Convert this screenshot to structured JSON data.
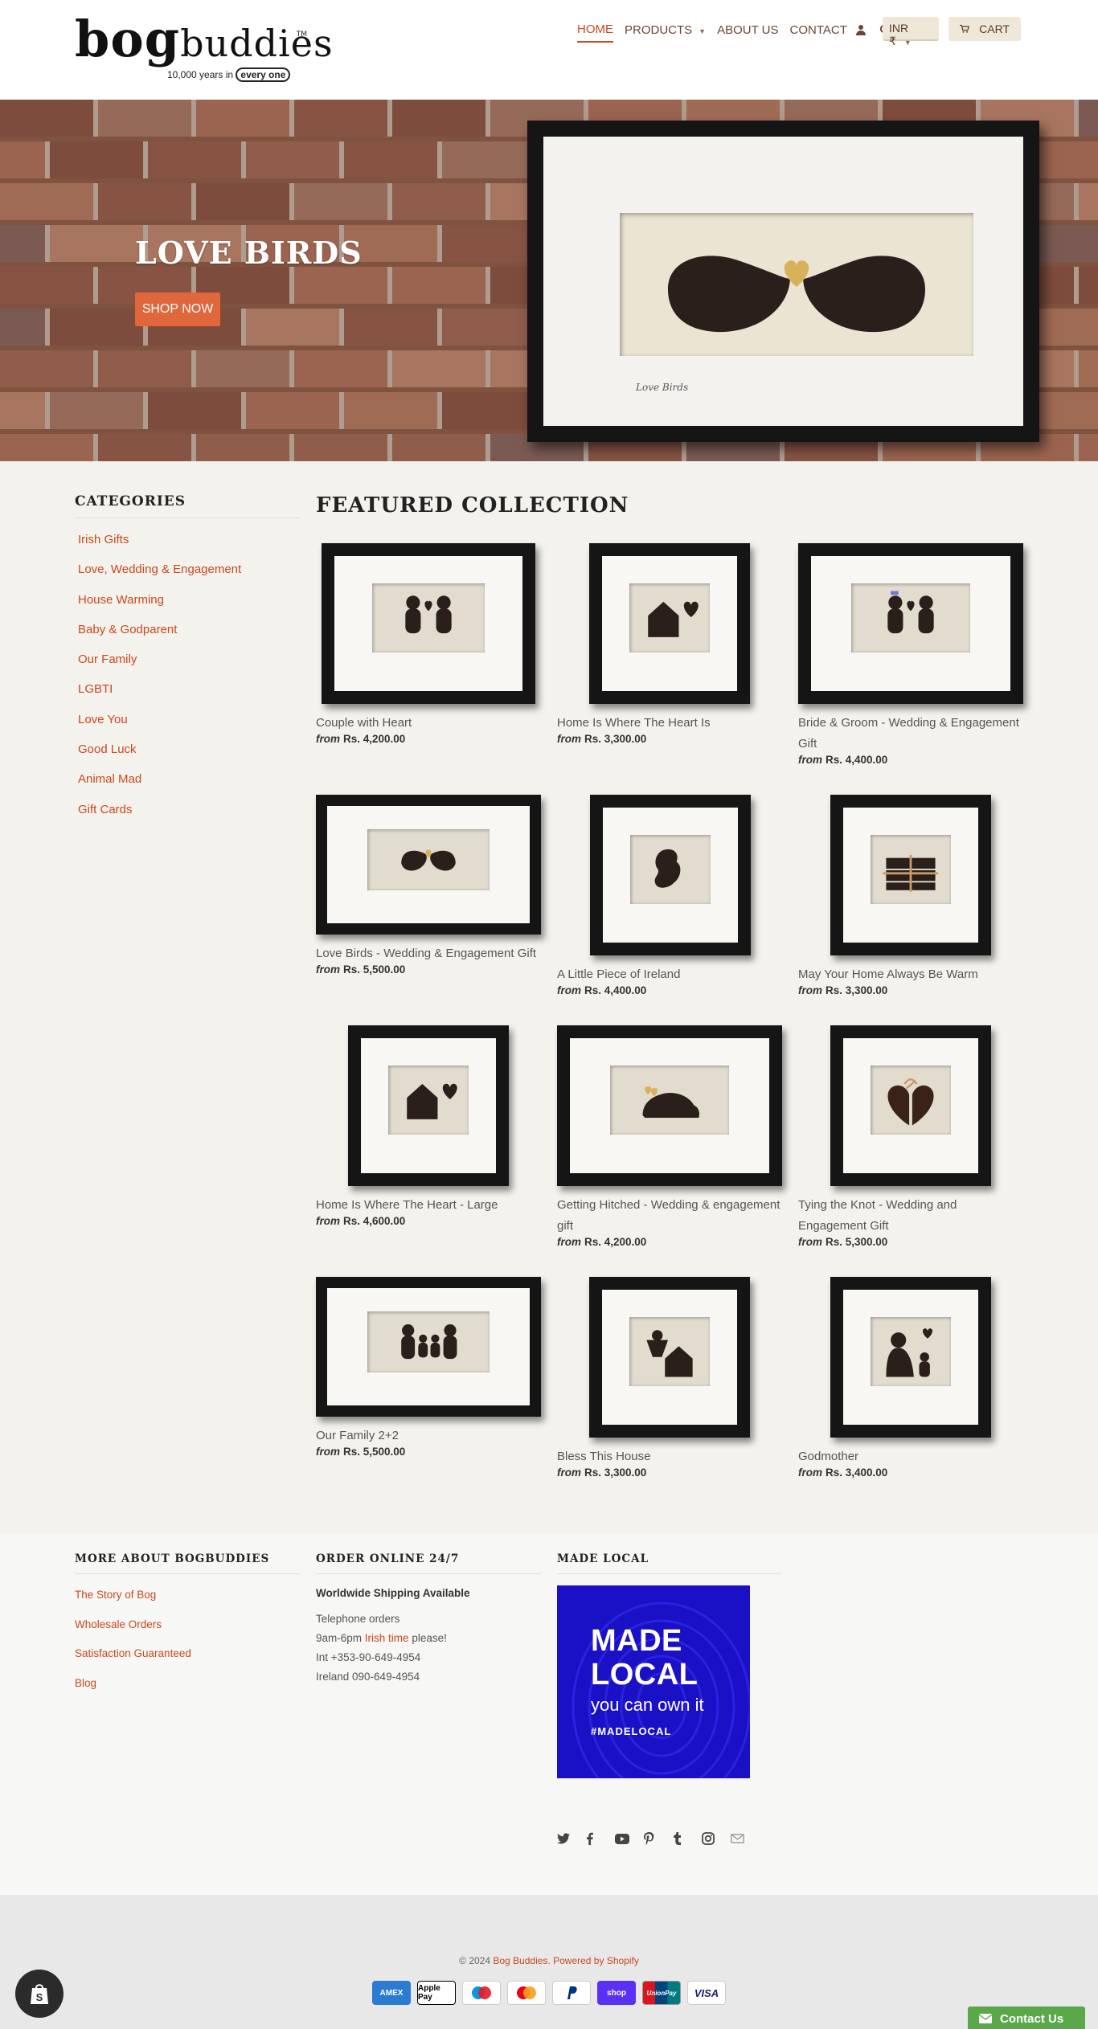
{
  "brand": {
    "logo_word_big": "bog",
    "logo_word_small": "buddies",
    "tagline_prefix": "10,000 years in",
    "tagline_ring": "every one",
    "trademark": "TM"
  },
  "nav": {
    "items": [
      {
        "label": "HOME",
        "active": true
      },
      {
        "label": "PRODUCTS",
        "dropdown": true
      },
      {
        "label": "ABOUT US"
      },
      {
        "label": "CONTACT"
      }
    ],
    "currency": "INR ₹",
    "cart_label": "CART"
  },
  "hero": {
    "title": "LOVE BIRDS",
    "button": "SHOP NOW",
    "frame_caption": "Love Birds"
  },
  "sidebar": {
    "heading": "CATEGORIES",
    "items": [
      "Irish Gifts",
      "Love, Wedding & Engagement",
      "House Warming",
      "Baby & Godparent",
      "Our Family",
      "LGBTI",
      "Love You",
      "Good Luck",
      "Animal Mad",
      "Gift Cards"
    ]
  },
  "featured": {
    "heading": "FEATURED COLLECTION",
    "from_label": "from",
    "products": [
      {
        "name": "Couple with Heart",
        "price": "Rs. 4,200.00",
        "icon": "couple-heart-icon"
      },
      {
        "name": "Home Is Where The Heart Is",
        "price": "Rs. 3,300.00",
        "icon": "house-heart-icon"
      },
      {
        "name": "Bride & Groom - Wedding & Engagement Gift",
        "price": "Rs. 4,400.00",
        "icon": "bride-groom-icon"
      },
      {
        "name": "Love Birds - Wedding & Engagement Gift",
        "price": "Rs. 5,500.00",
        "icon": "love-birds-icon"
      },
      {
        "name": "A Little Piece of Ireland",
        "price": "Rs. 4,400.00",
        "icon": "ireland-map-icon"
      },
      {
        "name": "May Your Home Always Be Warm",
        "price": "Rs. 3,300.00",
        "icon": "turf-bundle-icon"
      },
      {
        "name": "Home Is Where The Heart - Large",
        "price": "Rs. 4,600.00",
        "icon": "house-heart-icon"
      },
      {
        "name": "Getting Hitched - Wedding & engagement gift",
        "price": "Rs. 4,200.00",
        "icon": "car-icon"
      },
      {
        "name": "Tying the Knot - Wedding and Engagement Gift",
        "price": "Rs. 5,300.00",
        "icon": "knot-heart-icon"
      },
      {
        "name": "Our Family 2+2",
        "price": "Rs. 5,500.00",
        "icon": "family-icon"
      },
      {
        "name": "Bless This House",
        "price": "Rs. 3,300.00",
        "icon": "angel-house-icon"
      },
      {
        "name": "Godmother",
        "price": "Rs. 3,400.00",
        "icon": "godmother-icon"
      }
    ]
  },
  "footer": {
    "about": {
      "heading": "MORE ABOUT BOGBUDDIES",
      "links": [
        "The Story of Bog",
        "Wholesale Orders",
        "Satisfaction Guaranteed",
        "Blog"
      ]
    },
    "order": {
      "heading": "ORDER ONLINE 24/7",
      "shipping": "Worldwide Shipping Available",
      "tel_label": "Telephone orders",
      "hours_prefix": "9am-6pm",
      "hours_link": "Irish time",
      "hours_suffix": "please!",
      "intl": "Int +353-90-649-4954",
      "ireland": "Ireland 090-649-4954"
    },
    "local": {
      "heading": "MADE LOCAL",
      "line1": "MADE",
      "line2": "LOCAL",
      "line3": "you can own it",
      "line4": "#MADELOCAL"
    },
    "social_icons": [
      "twitter-icon",
      "facebook-icon",
      "youtube-icon",
      "pinterest-icon",
      "tumblr-icon",
      "instagram-icon",
      "email-icon"
    ],
    "copyright_prefix": "© 2024",
    "copyright_brand": "Bog Buddies",
    "powered": "Powered by Shopify",
    "payments": [
      "AMEX",
      "Apple Pay",
      "Maestro",
      "Mastercard",
      "PayPal",
      "shop",
      "UnionPay",
      "VISA"
    ],
    "contact_button": "Contact Us"
  }
}
